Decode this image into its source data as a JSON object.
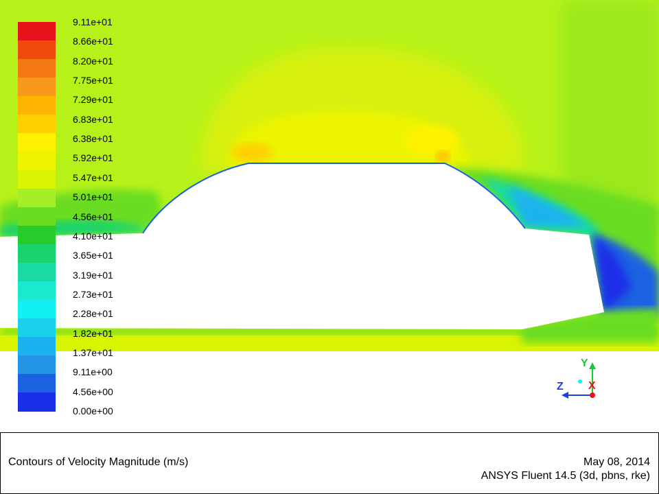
{
  "legend": {
    "labels": [
      "9.11e+01",
      "8.66e+01",
      "8.20e+01",
      "7.75e+01",
      "7.29e+01",
      "6.83e+01",
      "6.38e+01",
      "5.92e+01",
      "5.47e+01",
      "5.01e+01",
      "4.56e+01",
      "4.10e+01",
      "3.65e+01",
      "3.19e+01",
      "2.73e+01",
      "2.28e+01",
      "1.82e+01",
      "1.37e+01",
      "9.11e+00",
      "4.56e+00",
      "0.00e+00"
    ],
    "colors": [
      "#e8141c",
      "#f04a0a",
      "#f37812",
      "#f8981c",
      "#ffb400",
      "#ffd000",
      "#fff200",
      "#ecf400",
      "#d9f400",
      "#a6ee2a",
      "#6add22",
      "#27cc2a",
      "#19d36e",
      "#19dba2",
      "#1ae9cf",
      "#13f0f3",
      "#1bd1ee",
      "#1ab2f0",
      "#2494e6",
      "#1a62e2",
      "#1a2ee8"
    ]
  },
  "info": {
    "title": "Contours of Velocity Magnitude (m/s)",
    "date": "May 08, 2014",
    "software": "ANSYS Fluent 14.5 (3d, pbns, rke)"
  },
  "axes": {
    "y_label": "Y",
    "z_label": "Z",
    "x_label": "X"
  }
}
